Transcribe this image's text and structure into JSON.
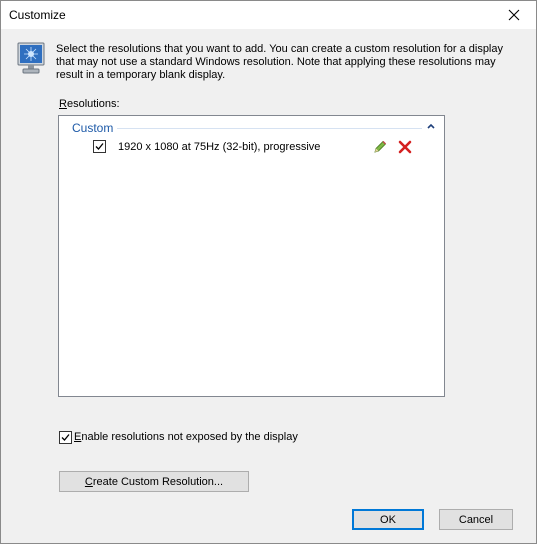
{
  "window": {
    "title": "Customize",
    "close_icon": "close-icon"
  },
  "description": "Select the resolutions that you want to add. You can create a custom resolution for a display that may not use a standard Windows resolution. Note that applying these resolutions may result in a temporary blank display.",
  "resolutions": {
    "label_prefix": "",
    "label_underlined": "R",
    "label_rest": "esolutions:",
    "group": {
      "name": "Custom",
      "collapsed": false,
      "items": [
        {
          "text": "1920 x 1080 at 75Hz (32-bit), progressive",
          "checked": true
        }
      ]
    }
  },
  "enable_option": {
    "underlined": "E",
    "rest": "nable resolutions not exposed by the display",
    "checked": true
  },
  "buttons": {
    "create_underlined": "C",
    "create_rest": "reate Custom Resolution...",
    "ok": "OK",
    "cancel": "Cancel"
  },
  "colors": {
    "accent": "#0078d7",
    "group_header": "#1e5aa8",
    "delete": "#d42020",
    "edit": "#5a9a2a"
  }
}
